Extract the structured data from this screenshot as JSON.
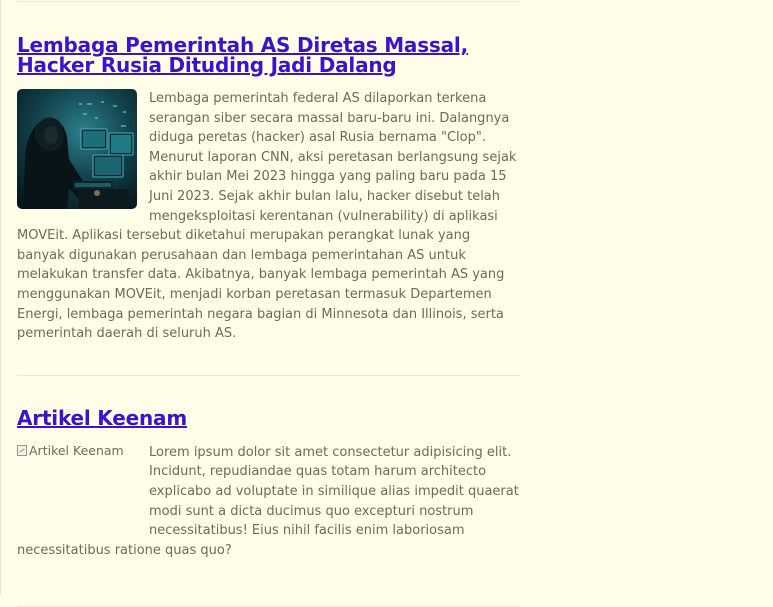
{
  "articles": [
    {
      "title": "Lembaga Pemerintah AS Diretas Massal, Hacker Rusia Dituding Jadi Dalang",
      "image": "hacker-hoodie-photo",
      "body": "Lembaga pemerintah federal AS dilaporkan terkena serangan siber secara massal baru-baru ini. Dalangnya diduga peretas (hacker) asal Rusia bernama \"Clop\". Menurut laporan CNN, aksi peretasan berlangsung sejak akhir bulan Mei 2023 hingga yang paling baru pada 15 Juni 2023. Sejak akhir bulan lalu, hacker disebut telah mengeksploitasi kerentanan (vulnerability) di aplikasi MOVEit. Aplikasi tersebut diketahui merupakan perangkat lunak yang banyak digunakan perusahaan dan lembaga pemerintahan AS untuk melakukan transfer data. Akibatnya, banyak lembaga pemerintah AS yang menggunakan MOVEit, menjadi korban peretasan termasuk Departemen Energi, lembaga pemerintah negara bagian di Minnesota dan Illinois, serta pemerintah daerah di seluruh AS."
    },
    {
      "title": "Artikel Keenam",
      "image_alt": "Artikel Keenam",
      "body": "Lorem ipsum dolor sit amet consectetur adipisicing elit. Incidunt, repudiandae quas totam harum architecto explicabo ad voluptate in similique alias impedit quaerat modi sunt a dicta ducimus quo excepturi nostrum necessitatibus! Eius nihil facilis enim laboriosam necessitatibus ratione quas quo?"
    }
  ],
  "colors": {
    "background": "#fffee9",
    "link": "#3d12cf",
    "text": "#6e6a5c",
    "divider": "#ecead6"
  }
}
